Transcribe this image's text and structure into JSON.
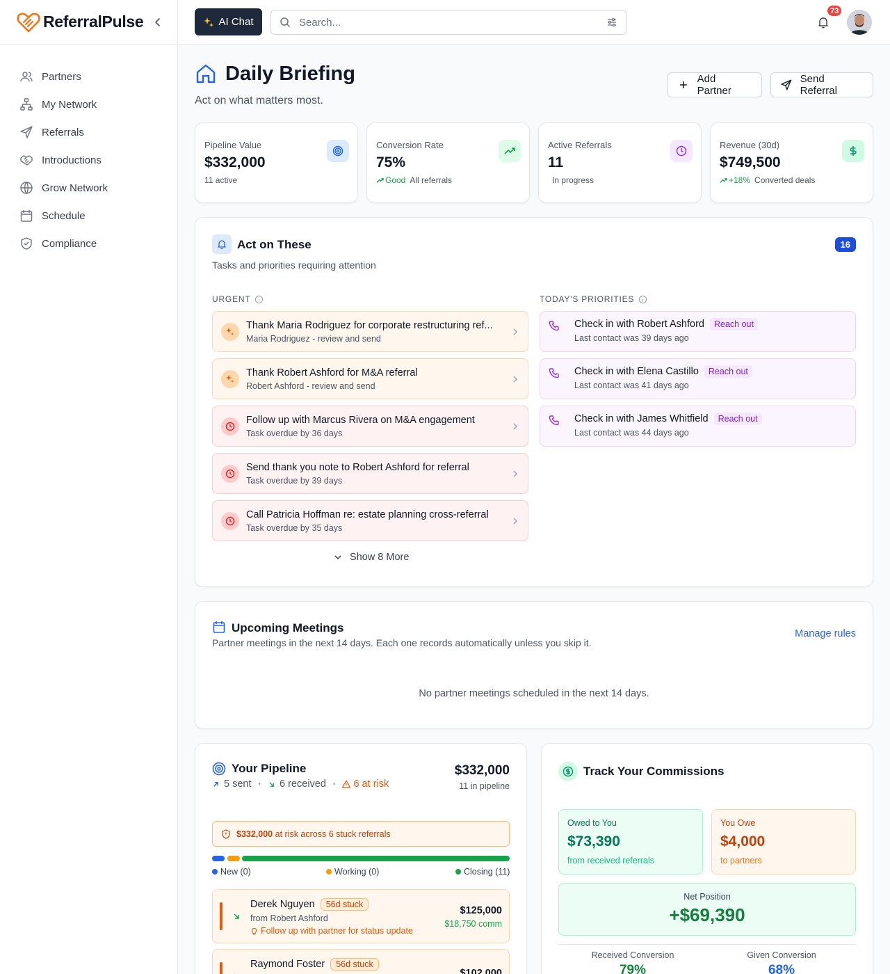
{
  "app": {
    "name": "ReferralPulse"
  },
  "sidebar": {
    "items": [
      {
        "label": "Partners",
        "icon": "users-icon"
      },
      {
        "label": "My Network",
        "icon": "network-icon"
      },
      {
        "label": "Referrals",
        "icon": "send-icon"
      },
      {
        "label": "Introductions",
        "icon": "handshake-icon"
      },
      {
        "label": "Grow Network",
        "icon": "globe-icon"
      },
      {
        "label": "Schedule",
        "icon": "calendar-icon"
      },
      {
        "label": "Compliance",
        "icon": "shield-icon"
      }
    ]
  },
  "topbar": {
    "ai_chat_label": "AI Chat",
    "search_placeholder": "Search...",
    "notifications_count": "73"
  },
  "header": {
    "title": "Daily Briefing",
    "subtitle": "Act on what matters most.",
    "add_partner_label": "Add Partner",
    "send_referral_label": "Send Referral"
  },
  "stats": [
    {
      "label": "Pipeline Value",
      "value": "$332,000",
      "sub": "11 active",
      "trend": "",
      "color": "#2563eb",
      "bg": "#dbeafe",
      "icon": "target-icon"
    },
    {
      "label": "Conversion Rate",
      "value": "75%",
      "sub": "All referrals",
      "trend": "Good",
      "color": "#16a34a",
      "bg": "#dcfce7",
      "icon": "trending-up-icon"
    },
    {
      "label": "Active Referrals",
      "value": "11",
      "sub": "In progress",
      "trend": "",
      "color": "#9333ea",
      "bg": "#f3e8ff",
      "icon": "clock-icon"
    },
    {
      "label": "Revenue (30d)",
      "value": "$749,500",
      "sub": "Converted deals",
      "trend": "+18%",
      "color": "#059669",
      "bg": "#d1fae5",
      "icon": "dollar-icon"
    }
  ],
  "act": {
    "title": "Act on These",
    "subtitle": "Tasks and priorities requiring attention",
    "count": "16",
    "urgent_heading": "URGENT",
    "priorities_heading": "TODAY'S PRIORITIES",
    "urgent": [
      {
        "title": "Thank Maria Rodriguez for corporate restructuring ref...",
        "sub": "Maria Rodriguez - review and send",
        "kind": "thank"
      },
      {
        "title": "Thank Robert Ashford for M&A referral",
        "sub": "Robert Ashford - review and send",
        "kind": "thank"
      },
      {
        "title": "Follow up with Marcus Rivera on M&A engagement",
        "sub": "Task overdue by 36 days",
        "kind": "overdue"
      },
      {
        "title": "Send thank you note to Robert Ashford for referral",
        "sub": "Task overdue by 39 days",
        "kind": "overdue"
      },
      {
        "title": "Call Patricia Hoffman re: estate planning cross-referral",
        "sub": "Task overdue by 35 days",
        "kind": "overdue"
      }
    ],
    "priorities": [
      {
        "title": "Check in with Robert Ashford",
        "tag": "Reach out",
        "sub": "Last contact was 39 days ago"
      },
      {
        "title": "Check in with Elena Castillo",
        "tag": "Reach out",
        "sub": "Last contact was 41 days ago"
      },
      {
        "title": "Check in with James Whitfield",
        "tag": "Reach out",
        "sub": "Last contact was 44 days ago"
      }
    ],
    "show_more": "Show 8 More"
  },
  "meetings": {
    "title": "Upcoming Meetings",
    "subtitle": "Partner meetings in the next 14 days. Each one records automatically unless you skip it.",
    "manage_label": "Manage rules",
    "empty": "No partner meetings scheduled in the next 14 days."
  },
  "pipeline": {
    "title": "Your Pipeline",
    "sent": "5 sent",
    "received": "6 received",
    "at_risk": "6 at risk",
    "total": "$332,000",
    "count": "11 in pipeline",
    "risk_amount": "$332,000",
    "risk_text": "at risk across 6 stuck referrals",
    "stages": [
      {
        "label": "New (0)",
        "color": "#2563eb"
      },
      {
        "label": "Working (0)",
        "color": "#f59e0b"
      },
      {
        "label": "Closing (11)",
        "color": "#16a34a"
      }
    ],
    "deals": [
      {
        "name": "Derek Nguyen",
        "stuck": "56d stuck",
        "from": "from Robert Ashford",
        "tip": "Follow up with partner for status update",
        "amount": "$125,000",
        "commission": "$18,750 comm"
      },
      {
        "name": "Raymond Foster",
        "stuck": "56d stuck",
        "amount": "$102,000"
      }
    ]
  },
  "commissions": {
    "title": "Track Your Commissions",
    "owed_label": "Owed to You",
    "owed_value": "$73,390",
    "owed_sub": "from received referrals",
    "owe_label": "You Owe",
    "owe_value": "$4,000",
    "owe_sub": "to partners",
    "net_label": "Net Position",
    "net_value": "+$69,390",
    "received_label": "Received Conversion",
    "received_value": "79%",
    "given_label": "Given Conversion",
    "given_value": "68%"
  }
}
